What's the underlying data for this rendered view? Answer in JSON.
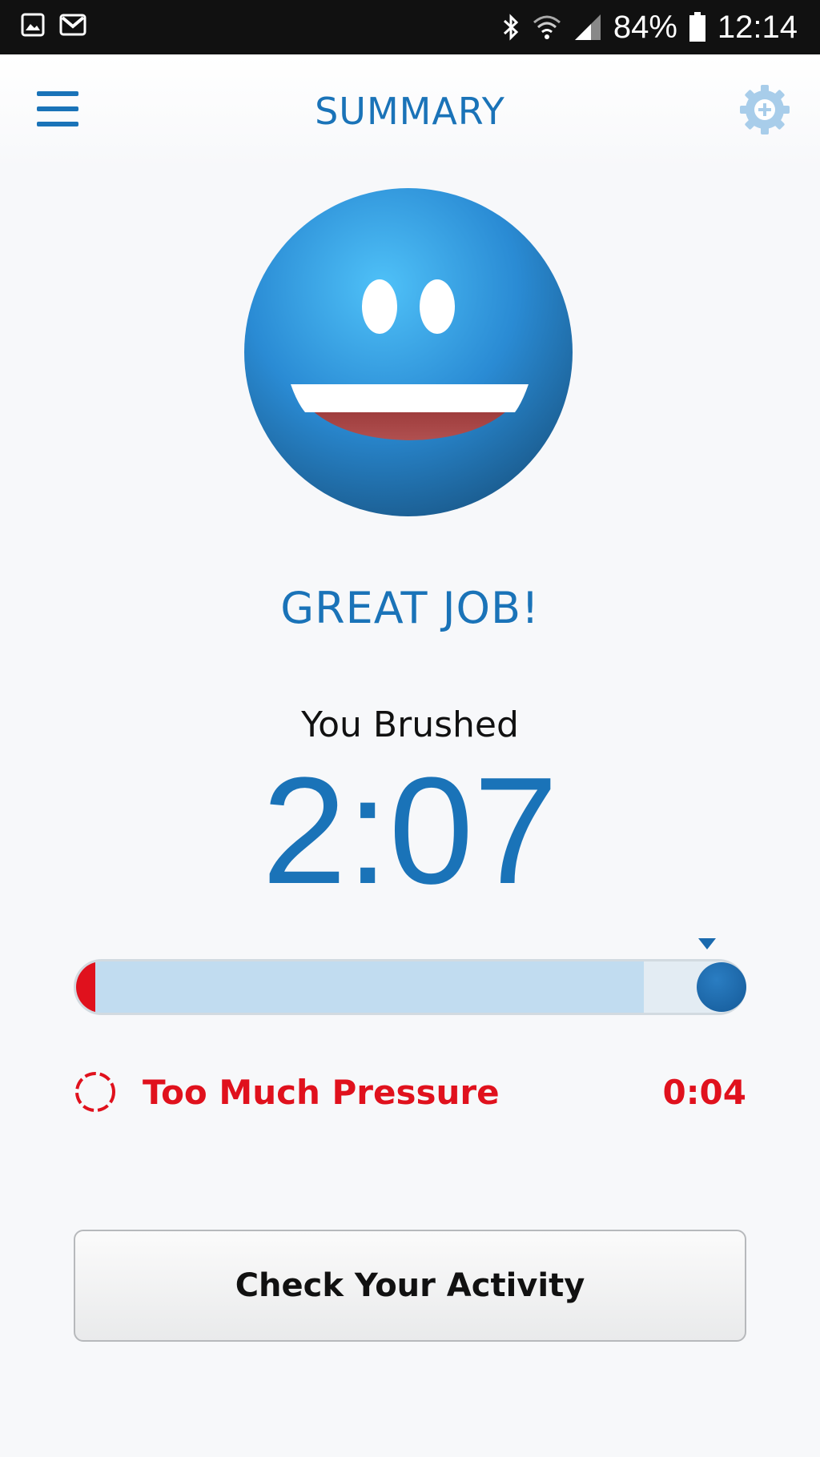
{
  "status_bar": {
    "battery": "84%",
    "time": "12:14",
    "icons": [
      "gallery-icon",
      "gmail-icon",
      "bluetooth-icon",
      "wifi-icon",
      "signal-icon",
      "battery-icon"
    ]
  },
  "header": {
    "title": "SUMMARY",
    "menu_icon": "hamburger-menu-icon",
    "settings_icon": "gear-plus-icon"
  },
  "smiley": {
    "icon": "smiley-face-icon",
    "color": "#2a8bd4"
  },
  "message": {
    "headline": "GREAT JOB!",
    "brushed_label": "You Brushed",
    "brush_time": "2:07"
  },
  "progress": {
    "fill_fraction": 0.85,
    "pressure_marker_fraction": 0.03,
    "track_color": "#c1dcf0",
    "pressure_color": "#e0111d",
    "knob_color": "#1a6aae"
  },
  "pressure": {
    "label": "Too Much Pressure",
    "time": "0:04",
    "icon": "pressure-circle-icon",
    "color": "#e0111d"
  },
  "actions": {
    "check_activity_label": "Check Your Activity"
  },
  "colors": {
    "primary": "#1a73b8",
    "alert": "#e0111d",
    "background": "#f7f8fa"
  }
}
